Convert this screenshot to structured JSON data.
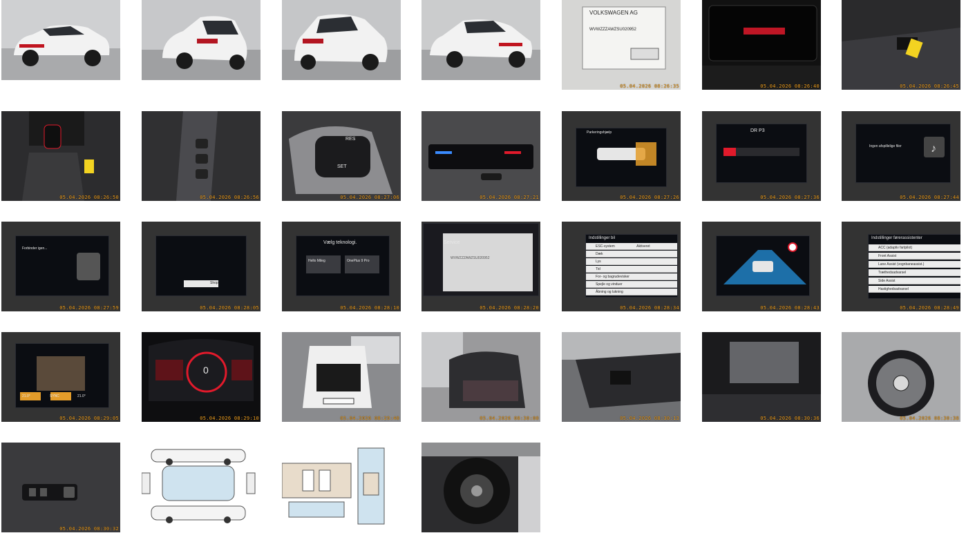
{
  "gallery": {
    "title": "",
    "photos": [
      {
        "name": "exterior-front-left",
        "timestamp": ""
      },
      {
        "name": "exterior-rear-left",
        "timestamp": ""
      },
      {
        "name": "exterior-rear-right",
        "timestamp": ""
      },
      {
        "name": "exterior-front-right",
        "timestamp": ""
      },
      {
        "name": "vin-plate",
        "timestamp": "05.04.2026 08:26:35",
        "texts": [
          "VOLKSWAGEN AG",
          "WVWZZZAWZSU020952"
        ]
      },
      {
        "name": "instrument-cluster-off",
        "timestamp": "05.04.2026 08:26:40"
      },
      {
        "name": "key-fob-seat",
        "timestamp": "05.04.2026 08:26:45"
      },
      {
        "name": "gear-shifter",
        "timestamp": "05.04.2026 08:26:50"
      },
      {
        "name": "drive-mode-buttons",
        "timestamp": "05.04.2026 08:26:56"
      },
      {
        "name": "steering-wheel-controls",
        "timestamp": "05.04.2026 08:27:06",
        "texts": [
          "RES",
          "SET"
        ]
      },
      {
        "name": "climate-panel",
        "timestamp": "05.04.2026 08:27:21"
      },
      {
        "name": "parking-aid-screen",
        "timestamp": "05.04.2026 08:27:26",
        "texts": [
          "Parkeringshjælp"
        ]
      },
      {
        "name": "radio-screen",
        "timestamp": "05.04.2026 08:27:36",
        "texts": [
          "DR P3"
        ]
      },
      {
        "name": "media-screen",
        "timestamp": "05.04.2026 08:27:44",
        "texts": [
          "Ingen afspillelige filer"
        ]
      },
      {
        "name": "phone-screen",
        "timestamp": "05.04.2026 08:27:59",
        "texts": [
          "Forbinder igen..."
        ]
      },
      {
        "name": "navigation-shop-screen",
        "timestamp": "05.04.2026 08:28:05",
        "texts": [
          "Shop"
        ]
      },
      {
        "name": "app-connect-screen",
        "timestamp": "05.04.2026 08:28:10",
        "texts": [
          "Vælg teknologi.",
          "Hello Mileg",
          "OnePlus 9 Pro"
        ]
      },
      {
        "name": "service-screen",
        "timestamp": "05.04.2026 08:28:20",
        "texts": [
          "Service",
          "WVWZZZAWZSU020952"
        ]
      },
      {
        "name": "car-settings-screen",
        "timestamp": "05.04.2026 08:28:34",
        "texts": [
          "Indstillinger bil",
          "ESC-system",
          "Aktiveret",
          "Dæk",
          "Lys",
          "Tid",
          "For- og bagrudevisker",
          "Spejle og vinduer",
          "Åbning og lukning"
        ]
      },
      {
        "name": "driver-assist-visual",
        "timestamp": "05.04.2026 08:28:43"
      },
      {
        "name": "driver-assist-settings",
        "timestamp": "05.04.2026 08:28:49",
        "texts": [
          "Indstillinger førerassistenter",
          "ACC (adaptiv fartpilot)",
          "Front Assist",
          "Lane Assist (vognbaneassist.)",
          "Trætheds­advarsel",
          "Side Assist",
          "Hastighedsadvarsel"
        ]
      },
      {
        "name": "seat-climate-screen",
        "timestamp": "05.04.2026 08:29:05",
        "texts": [
          "21.0°",
          "21.0°",
          "SYNC"
        ]
      },
      {
        "name": "digital-cockpit-on",
        "timestamp": "05.04.2026 08:29:10",
        "texts": [
          "0"
        ]
      },
      {
        "name": "trunk-open",
        "timestamp": "05.04.2026 08:29:40"
      },
      {
        "name": "rear-seats",
        "timestamp": "05.04.2026 08:30:00"
      },
      {
        "name": "dashboard-interior",
        "timestamp": "05.04.2026 08:30:13"
      },
      {
        "name": "sunroof-interior",
        "timestamp": "05.04.2026 08:30:36"
      },
      {
        "name": "steering-wheel",
        "timestamp": "05.04.2026 08:30:38"
      },
      {
        "name": "door-panel-buttons",
        "timestamp": "05.04.2026 08:30:32"
      },
      {
        "name": "damage-diagram-exterior",
        "timestamp": ""
      },
      {
        "name": "damage-diagram-interior",
        "timestamp": ""
      },
      {
        "name": "spare-wheel",
        "timestamp": ""
      }
    ]
  },
  "colors": {
    "timestamp": "#f0a020",
    "screen_bg": "#0b0d12",
    "accent_red": "#e11a2b",
    "car_white": "#f2f2f2"
  }
}
